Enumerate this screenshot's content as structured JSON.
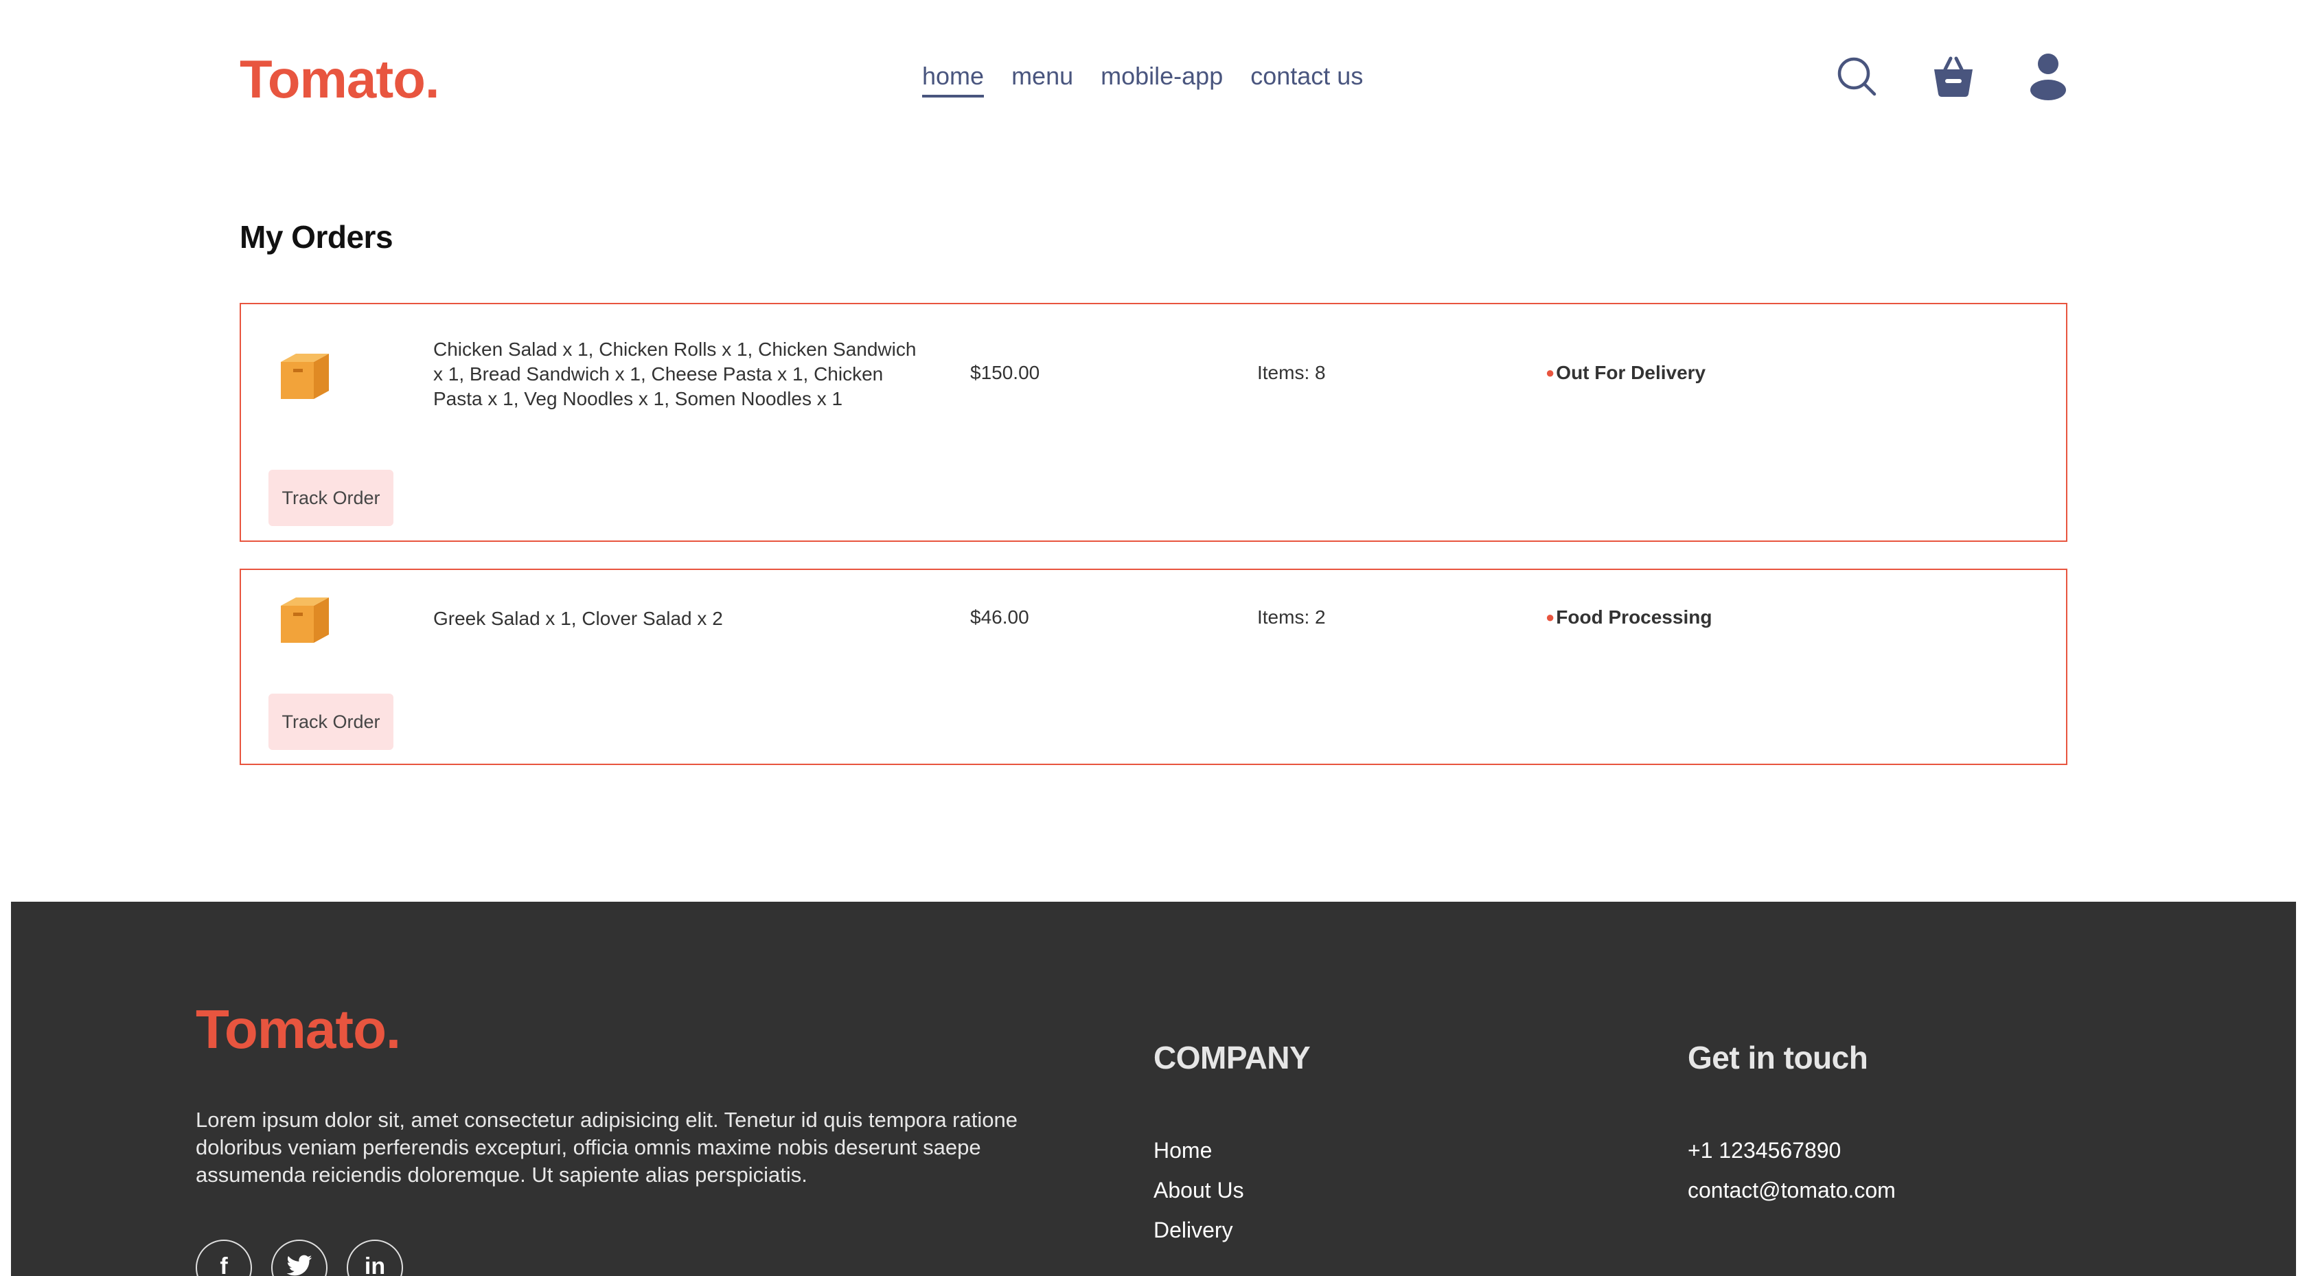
{
  "navbar": {
    "logo": "Tomato.",
    "menu": [
      "home",
      "menu",
      "mobile-app",
      "contact us"
    ],
    "active": "home"
  },
  "orders_page": {
    "title": "My Orders",
    "orders": [
      {
        "items": "Chicken Salad x 1, Chicken Rolls x 1, Chicken Sandwich x 1, Bread Sandwich x 1, Cheese Pasta x 1, Chicken Pasta x 1, Veg Noodles x 1, Somen Noodles x 1",
        "amount": "$150.00",
        "count": "Items: 8",
        "status_dot": "●",
        "status": "Out For Delivery",
        "button": "Track Order"
      },
      {
        "items": "Greek Salad x 1, Clover Salad x 2",
        "amount": "$46.00",
        "count": "Items: 2",
        "status_dot": "●",
        "status": "Food Processing",
        "button": "Track Order"
      }
    ]
  },
  "footer": {
    "logo": "Tomato.",
    "description": "Lorem ipsum dolor sit, amet consectetur adipisicing elit. Tenetur id quis tempora ratione doloribus veniam perferendis excepturi, officia omnis maxime nobis deserunt saepe assumenda reiciendis doloremque. Ut sapiente alias perspiciatis.",
    "socials": [
      {
        "icon": "facebook-icon",
        "glyph": "f"
      },
      {
        "icon": "twitter-icon",
        "glyph": ""
      },
      {
        "icon": "linkedin-icon",
        "glyph": "in"
      }
    ],
    "company": {
      "heading": "COMPANY",
      "links": [
        "Home",
        "About Us",
        "Delivery"
      ]
    },
    "contact": {
      "heading": "Get in touch",
      "phone": "+1 1234567890",
      "email": "contact@tomato.com"
    }
  },
  "colors": {
    "brand": "#e8553f",
    "nav_text": "#49557e",
    "footer_bg": "#323232",
    "button_bg": "#fde2e2"
  }
}
